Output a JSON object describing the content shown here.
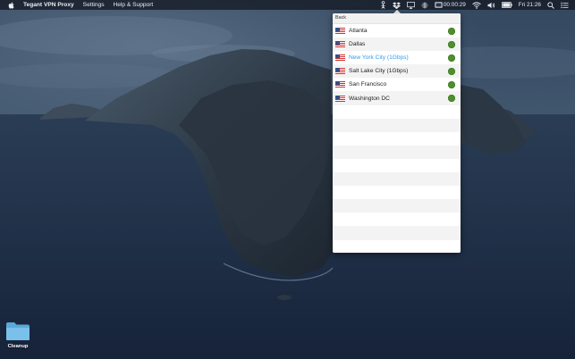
{
  "menubar": {
    "app_name": "Tegant VPN Proxy",
    "menu_items": [
      "Settings",
      "Help & Support"
    ],
    "timer": "00:00:29",
    "clock": "Fri 21:26"
  },
  "popover": {
    "back_label": "Back",
    "servers": [
      {
        "name": "Atlanta",
        "country": "US",
        "status": "online",
        "selected": false
      },
      {
        "name": "Dallas",
        "country": "US",
        "status": "online",
        "selected": false
      },
      {
        "name": "New York City (1Gbps)",
        "country": "US",
        "status": "online",
        "selected": true
      },
      {
        "name": "Salt Lake City (1Gbps)",
        "country": "US",
        "status": "online",
        "selected": false
      },
      {
        "name": "San Francisco",
        "country": "US",
        "status": "online",
        "selected": false
      },
      {
        "name": "Washington DC",
        "country": "US",
        "status": "online",
        "selected": false
      }
    ],
    "status_color": "#4e8e2e",
    "selected_color": "#2f9ee9"
  },
  "desktop": {
    "folder_label": "Cleanup"
  }
}
